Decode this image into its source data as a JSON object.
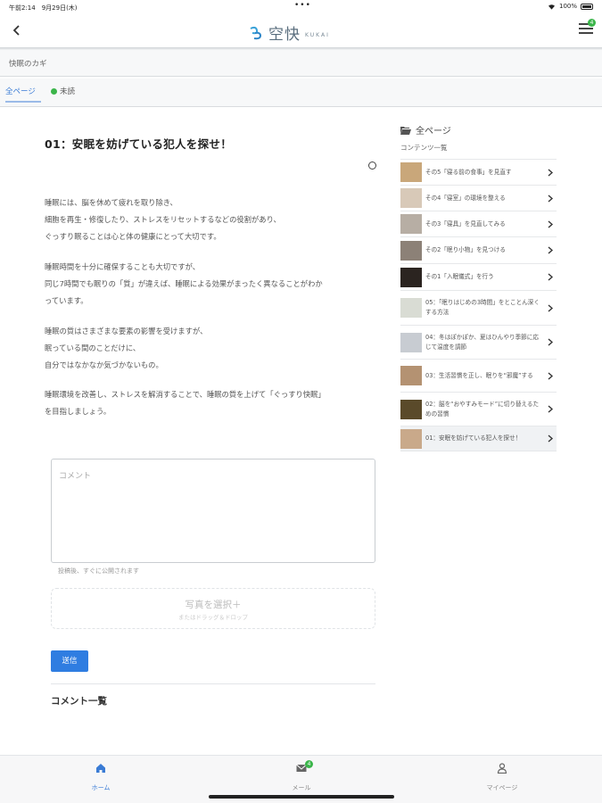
{
  "status": {
    "time": "午前2:14　9月29日(木)",
    "dots": "•••",
    "battery": "100%"
  },
  "header": {
    "logo_text": "空快",
    "logo_sub": "KUKAI",
    "menu_badge": "4"
  },
  "breadcrumb": "快眠のカギ",
  "tabs": {
    "all": "全ページ",
    "unread": "未読"
  },
  "article": {
    "title": "01：安眠を妨げている犯人を探せ！",
    "paragraphs": [
      [
        "睡眠には、脳を休めて疲れを取り除き、",
        "細胞を再生・修復したり、ストレスをリセットするなどの役割があり、",
        "ぐっすり眠ることは心と体の健康にとって大切です。"
      ],
      [
        "睡眠時間を十分に確保することも大切ですが、",
        "同じ7時間でも眠りの「質」が違えば、睡眠による効果がまったく異なることがわか",
        "っています。"
      ],
      [
        "睡眠の質はさまざまな要素の影響を受けますが、",
        "眠っている間のことだけに、",
        "自分ではなかなか気づかないもの。"
      ],
      [
        "睡眠環境を改善し、ストレスを解消することで、睡眠の質を上げて「ぐっすり快眠」",
        "を目指しましょう。"
      ]
    ]
  },
  "comment_form": {
    "placeholder": "コメント",
    "note": "投稿後、すぐに公開されます",
    "upload_main": "写真を選択＋",
    "upload_sub": "またはドラッグ＆ドロップ",
    "send": "送信",
    "list_title": "コメント一覧"
  },
  "sidebar": {
    "title": "全ページ",
    "subtitle": "コンテンツ一覧",
    "items": [
      {
        "label": "その5「寝る前の食事」を見直す",
        "color": "#c9a77a"
      },
      {
        "label": "その4「寝室」の環境を整える",
        "color": "#d8c9b8"
      },
      {
        "label": "その3「寝具」を見直してみる",
        "color": "#b7aea4"
      },
      {
        "label": "その2「眠り小物」を見つける",
        "color": "#8c8177"
      },
      {
        "label": "その1「入眠儀式」を行う",
        "color": "#2b2420"
      },
      {
        "label": "05：「眠りはじめの3時間」をとことん深くする方法",
        "color": "#d9dcd4"
      },
      {
        "label": "04：冬はぽかぽか、夏はひんやり季節に応じて温度を調節",
        "color": "#c8ccd2"
      },
      {
        "label": "03：生活習慣を正し、眠りを“邪魔”する",
        "color": "#b49272"
      },
      {
        "label": "02：脳を“おやすみモード”に切り替えるための習慣",
        "color": "#5a4a2a"
      },
      {
        "label": "01：安眠を妨げている犯人を探せ！",
        "color": "#c9a98a"
      }
    ]
  },
  "tabbar": {
    "home": "ホーム",
    "mail": "メール",
    "mail_badge": "4",
    "mypage": "マイページ"
  },
  "colors": {
    "accent": "#2f7de1",
    "badge": "#3bb54a"
  }
}
